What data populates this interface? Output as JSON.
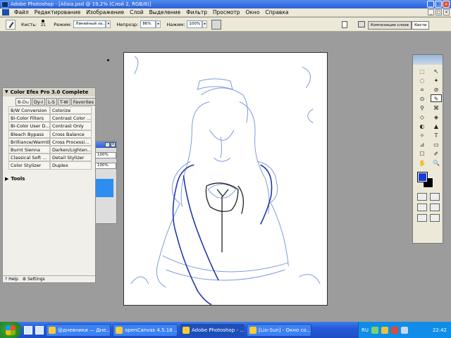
{
  "window": {
    "title": "Adobe Photoshop - [Alisia.psd @ 19,2% (Слой 2, RGB/8)]",
    "min": "_",
    "max": "□",
    "close": "×"
  },
  "menu": [
    "Файл",
    "Редактирование",
    "Изображение",
    "Слой",
    "Выделение",
    "Фильтр",
    "Просмотр",
    "Окно",
    "Справка"
  ],
  "options": {
    "brush_label": "Кисть:",
    "brush_size": "21",
    "mode_label": "Режим:",
    "mode_value": "Линейный за...",
    "opacity_label": "Непрозр:",
    "opacity_value": "86%",
    "flow_label": "Нажим:",
    "flow_value": "100%",
    "palette_tabs": [
      "Композиции слоев",
      "Кисти"
    ]
  },
  "color_efex": {
    "title": "Color Efex Pro 3.0 Complete",
    "tabs": [
      "B-Du",
      "Dy-I",
      "L-S",
      "T-W",
      "Favorites"
    ],
    "filters": [
      [
        "B/W Conversion",
        "Colorize"
      ],
      [
        "Bi-Color Filters",
        "Contrast Color ..."
      ],
      [
        "Bi-Color User D...",
        "Contrast Only"
      ],
      [
        "Bleach Bypass",
        "Cross Balance"
      ],
      [
        "Brilliance/Warmth",
        "Cross Processi..."
      ],
      [
        "Burnt Sienna",
        "Darken/Lighten..."
      ],
      [
        "Classical Soft ...",
        "Detail Stylizer"
      ],
      [
        "Color Stylizer",
        "Duplex"
      ]
    ],
    "tools_label": "Tools",
    "help_label": "Help",
    "settings_label": "Settings"
  },
  "layers_fragment": {
    "field1": "100%",
    "field2": "100%"
  },
  "tools": {
    "icons": [
      "⬚",
      "↖",
      "◌",
      "✦",
      "⌗",
      "⊘",
      "⊙",
      "✎",
      "⚲",
      "⌘",
      "◇",
      "◈",
      "◐",
      "▲",
      "✧",
      "T",
      "⊿",
      "▭",
      "☐",
      "✐",
      "✋",
      "🔍"
    ],
    "fg_color": "#1a3cd7",
    "bg_color": "#000000"
  },
  "taskbar": {
    "items": [
      "@дневники — Дне...",
      "openCanvas 4.5.18 ...",
      "Adobe Photoshop - ...",
      "[Lio-Sun] - Окно со..."
    ],
    "lang": "RU",
    "time": "22:42"
  }
}
